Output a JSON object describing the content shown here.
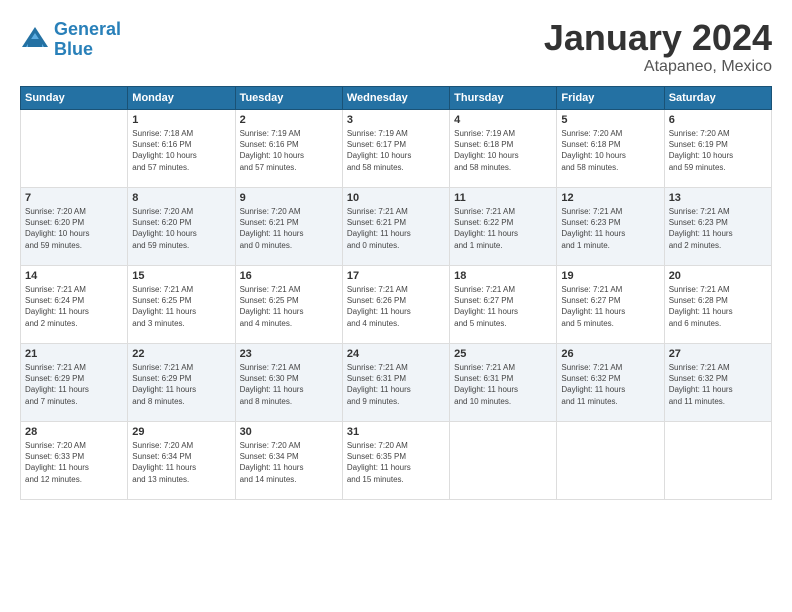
{
  "header": {
    "logo_line1": "General",
    "logo_line2": "Blue",
    "month": "January 2024",
    "location": "Atapaneo, Mexico"
  },
  "weekdays": [
    "Sunday",
    "Monday",
    "Tuesday",
    "Wednesday",
    "Thursday",
    "Friday",
    "Saturday"
  ],
  "rows": [
    [
      {
        "num": "",
        "info": ""
      },
      {
        "num": "1",
        "info": "Sunrise: 7:18 AM\nSunset: 6:16 PM\nDaylight: 10 hours\nand 57 minutes."
      },
      {
        "num": "2",
        "info": "Sunrise: 7:19 AM\nSunset: 6:16 PM\nDaylight: 10 hours\nand 57 minutes."
      },
      {
        "num": "3",
        "info": "Sunrise: 7:19 AM\nSunset: 6:17 PM\nDaylight: 10 hours\nand 58 minutes."
      },
      {
        "num": "4",
        "info": "Sunrise: 7:19 AM\nSunset: 6:18 PM\nDaylight: 10 hours\nand 58 minutes."
      },
      {
        "num": "5",
        "info": "Sunrise: 7:20 AM\nSunset: 6:18 PM\nDaylight: 10 hours\nand 58 minutes."
      },
      {
        "num": "6",
        "info": "Sunrise: 7:20 AM\nSunset: 6:19 PM\nDaylight: 10 hours\nand 59 minutes."
      }
    ],
    [
      {
        "num": "7",
        "info": "Sunrise: 7:20 AM\nSunset: 6:20 PM\nDaylight: 10 hours\nand 59 minutes."
      },
      {
        "num": "8",
        "info": "Sunrise: 7:20 AM\nSunset: 6:20 PM\nDaylight: 10 hours\nand 59 minutes."
      },
      {
        "num": "9",
        "info": "Sunrise: 7:20 AM\nSunset: 6:21 PM\nDaylight: 11 hours\nand 0 minutes."
      },
      {
        "num": "10",
        "info": "Sunrise: 7:21 AM\nSunset: 6:21 PM\nDaylight: 11 hours\nand 0 minutes."
      },
      {
        "num": "11",
        "info": "Sunrise: 7:21 AM\nSunset: 6:22 PM\nDaylight: 11 hours\nand 1 minute."
      },
      {
        "num": "12",
        "info": "Sunrise: 7:21 AM\nSunset: 6:23 PM\nDaylight: 11 hours\nand 1 minute."
      },
      {
        "num": "13",
        "info": "Sunrise: 7:21 AM\nSunset: 6:23 PM\nDaylight: 11 hours\nand 2 minutes."
      }
    ],
    [
      {
        "num": "14",
        "info": "Sunrise: 7:21 AM\nSunset: 6:24 PM\nDaylight: 11 hours\nand 2 minutes."
      },
      {
        "num": "15",
        "info": "Sunrise: 7:21 AM\nSunset: 6:25 PM\nDaylight: 11 hours\nand 3 minutes."
      },
      {
        "num": "16",
        "info": "Sunrise: 7:21 AM\nSunset: 6:25 PM\nDaylight: 11 hours\nand 4 minutes."
      },
      {
        "num": "17",
        "info": "Sunrise: 7:21 AM\nSunset: 6:26 PM\nDaylight: 11 hours\nand 4 minutes."
      },
      {
        "num": "18",
        "info": "Sunrise: 7:21 AM\nSunset: 6:27 PM\nDaylight: 11 hours\nand 5 minutes."
      },
      {
        "num": "19",
        "info": "Sunrise: 7:21 AM\nSunset: 6:27 PM\nDaylight: 11 hours\nand 5 minutes."
      },
      {
        "num": "20",
        "info": "Sunrise: 7:21 AM\nSunset: 6:28 PM\nDaylight: 11 hours\nand 6 minutes."
      }
    ],
    [
      {
        "num": "21",
        "info": "Sunrise: 7:21 AM\nSunset: 6:29 PM\nDaylight: 11 hours\nand 7 minutes."
      },
      {
        "num": "22",
        "info": "Sunrise: 7:21 AM\nSunset: 6:29 PM\nDaylight: 11 hours\nand 8 minutes."
      },
      {
        "num": "23",
        "info": "Sunrise: 7:21 AM\nSunset: 6:30 PM\nDaylight: 11 hours\nand 8 minutes."
      },
      {
        "num": "24",
        "info": "Sunrise: 7:21 AM\nSunset: 6:31 PM\nDaylight: 11 hours\nand 9 minutes."
      },
      {
        "num": "25",
        "info": "Sunrise: 7:21 AM\nSunset: 6:31 PM\nDaylight: 11 hours\nand 10 minutes."
      },
      {
        "num": "26",
        "info": "Sunrise: 7:21 AM\nSunset: 6:32 PM\nDaylight: 11 hours\nand 11 minutes."
      },
      {
        "num": "27",
        "info": "Sunrise: 7:21 AM\nSunset: 6:32 PM\nDaylight: 11 hours\nand 11 minutes."
      }
    ],
    [
      {
        "num": "28",
        "info": "Sunrise: 7:20 AM\nSunset: 6:33 PM\nDaylight: 11 hours\nand 12 minutes."
      },
      {
        "num": "29",
        "info": "Sunrise: 7:20 AM\nSunset: 6:34 PM\nDaylight: 11 hours\nand 13 minutes."
      },
      {
        "num": "30",
        "info": "Sunrise: 7:20 AM\nSunset: 6:34 PM\nDaylight: 11 hours\nand 14 minutes."
      },
      {
        "num": "31",
        "info": "Sunrise: 7:20 AM\nSunset: 6:35 PM\nDaylight: 11 hours\nand 15 minutes."
      },
      {
        "num": "",
        "info": ""
      },
      {
        "num": "",
        "info": ""
      },
      {
        "num": "",
        "info": ""
      }
    ]
  ]
}
